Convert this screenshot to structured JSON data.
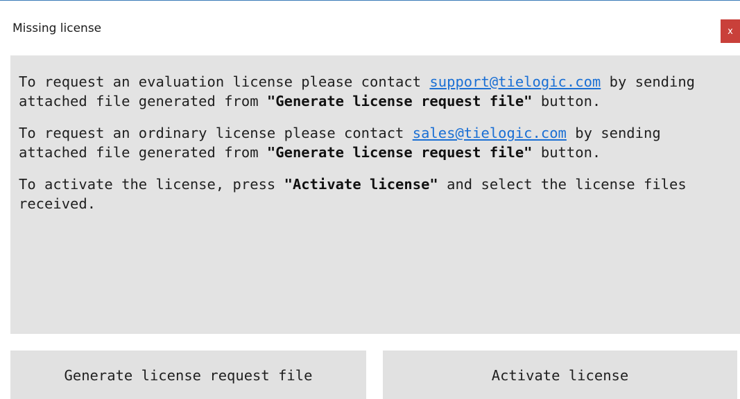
{
  "window": {
    "title": "Missing license",
    "close_label": "x"
  },
  "message": {
    "p1": {
      "text_a": "To request an evaluation license please contact ",
      "link": "support@tielogic.com",
      "text_b": " by sending attached file generated from ",
      "bold": "\"Generate license request file\"",
      "text_c": " button."
    },
    "p2": {
      "text_a": "To request an ordinary license please contact ",
      "link": "sales@tielogic.com",
      "text_b": " by sending attached file generated from ",
      "bold": "\"Generate license request file\"",
      "text_c": " button."
    },
    "p3": {
      "text_a": "To activate the license, press ",
      "bold": "\"Activate license\"",
      "text_b": " and select the license files received."
    }
  },
  "buttons": {
    "generate_label": "Generate license request file",
    "activate_label": "Activate license"
  },
  "colors": {
    "close_button_bg": "#c9403a",
    "panel_bg": "#e3e3e3",
    "button_bg": "#e1e1e1",
    "link": "#1a6fd4",
    "window_border": "#3a7ab8"
  }
}
